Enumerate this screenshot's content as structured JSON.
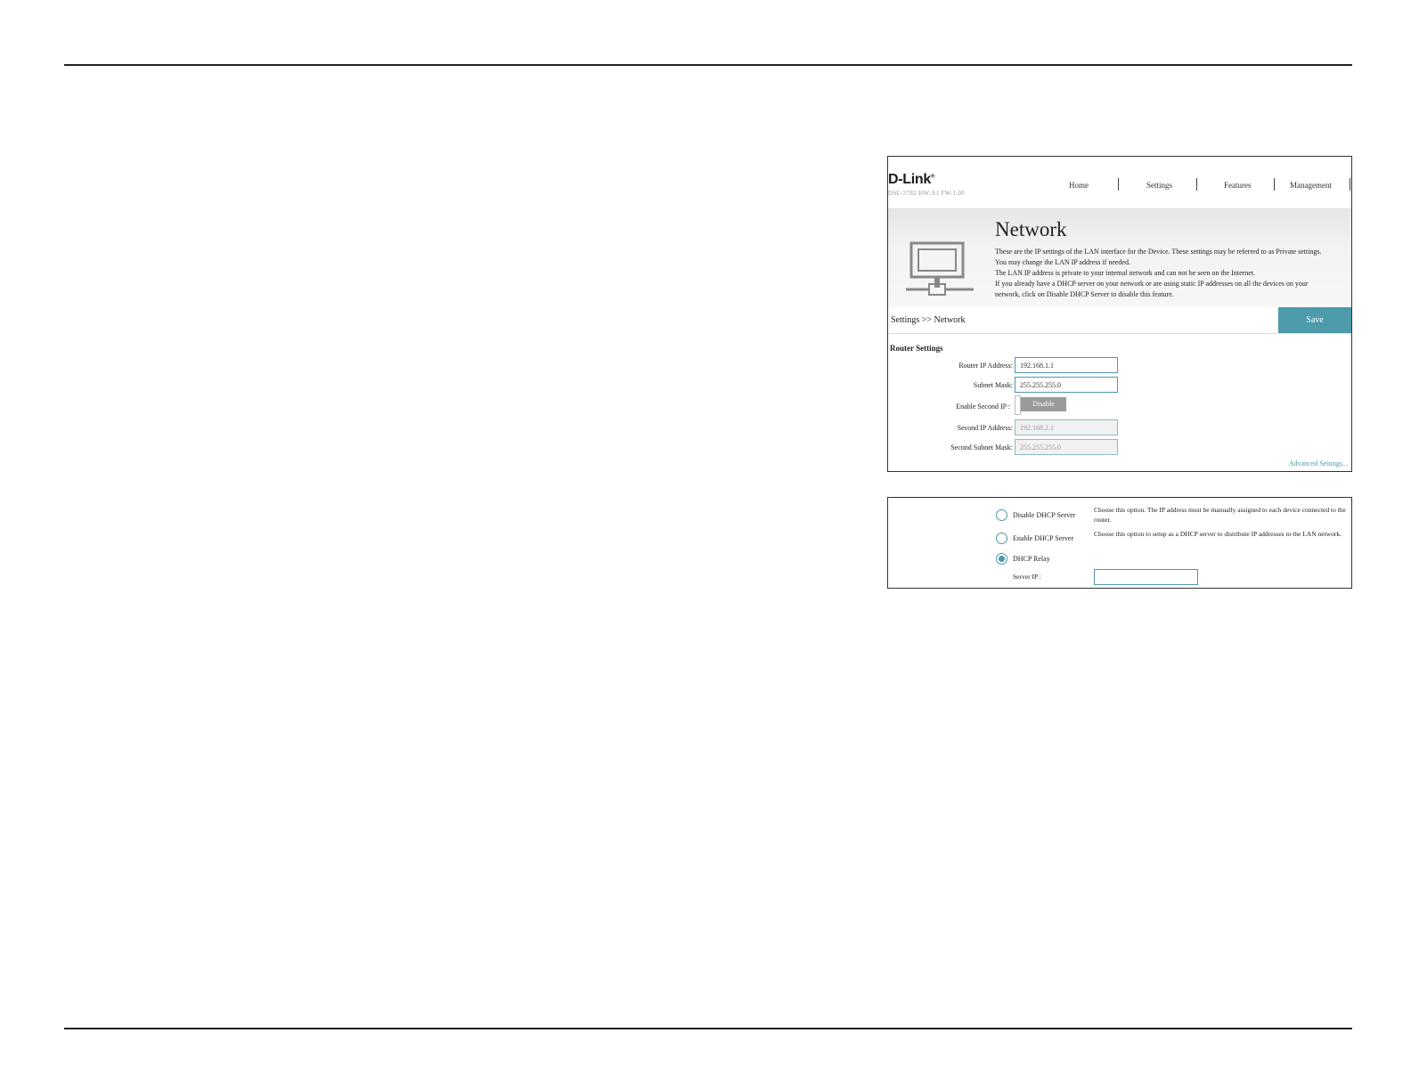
{
  "router_ui": {
    "logo": "D-Link",
    "model": "DSL-3782  HW:A1  FW:1.00",
    "nav": [
      "Home",
      "Settings",
      "Features",
      "Management"
    ],
    "page_title": "Network",
    "description": [
      "These are the IP settings of the LAN interface for the Device. These settings may be referred to as Private settings.",
      "You may change the LAN IP address if needed.",
      "The LAN IP address is private to your internal network and can not be seen on the Internet.",
      "If you already have a DHCP server on your network or are using static IP addresses on all the devices on your",
      "network, click on Disable DHCP Server to disable this feature."
    ],
    "breadcrumb": "Settings >> Network",
    "save_label": "Save",
    "section_title": "Router Settings",
    "fields": {
      "router_ip_label": "Router IP Address:",
      "router_ip_value": "192.168.1.1",
      "subnet_label": "Subnet Mask:",
      "subnet_value": "255.255.255.0",
      "second_ip_enable_label": "Enable Second IP :",
      "second_ip_toggle": "Disable",
      "second_ip_label": "Second IP Address:",
      "second_ip_value": "192.168.2.1",
      "second_subnet_label": "Second Subnet Mask:",
      "second_subnet_value": "255.255.255.0"
    },
    "advanced_link": "Advanced Settings...",
    "dhcp": {
      "options": [
        {
          "label": "Disable DHCP Server",
          "desc": "Choose this option. The IP address must be manually assigned to each device connected to the router.",
          "checked": false
        },
        {
          "label": "Enable DHCP Server",
          "desc": "Choose this option to setup as a DHCP server to distribute IP addresses to the LAN network.",
          "checked": false
        },
        {
          "label": "DHCP Relay",
          "desc": "",
          "checked": true
        }
      ],
      "server_ip_label": "Server IP :",
      "server_ip_value": ""
    },
    "accent_color": "#4c9aaa"
  }
}
